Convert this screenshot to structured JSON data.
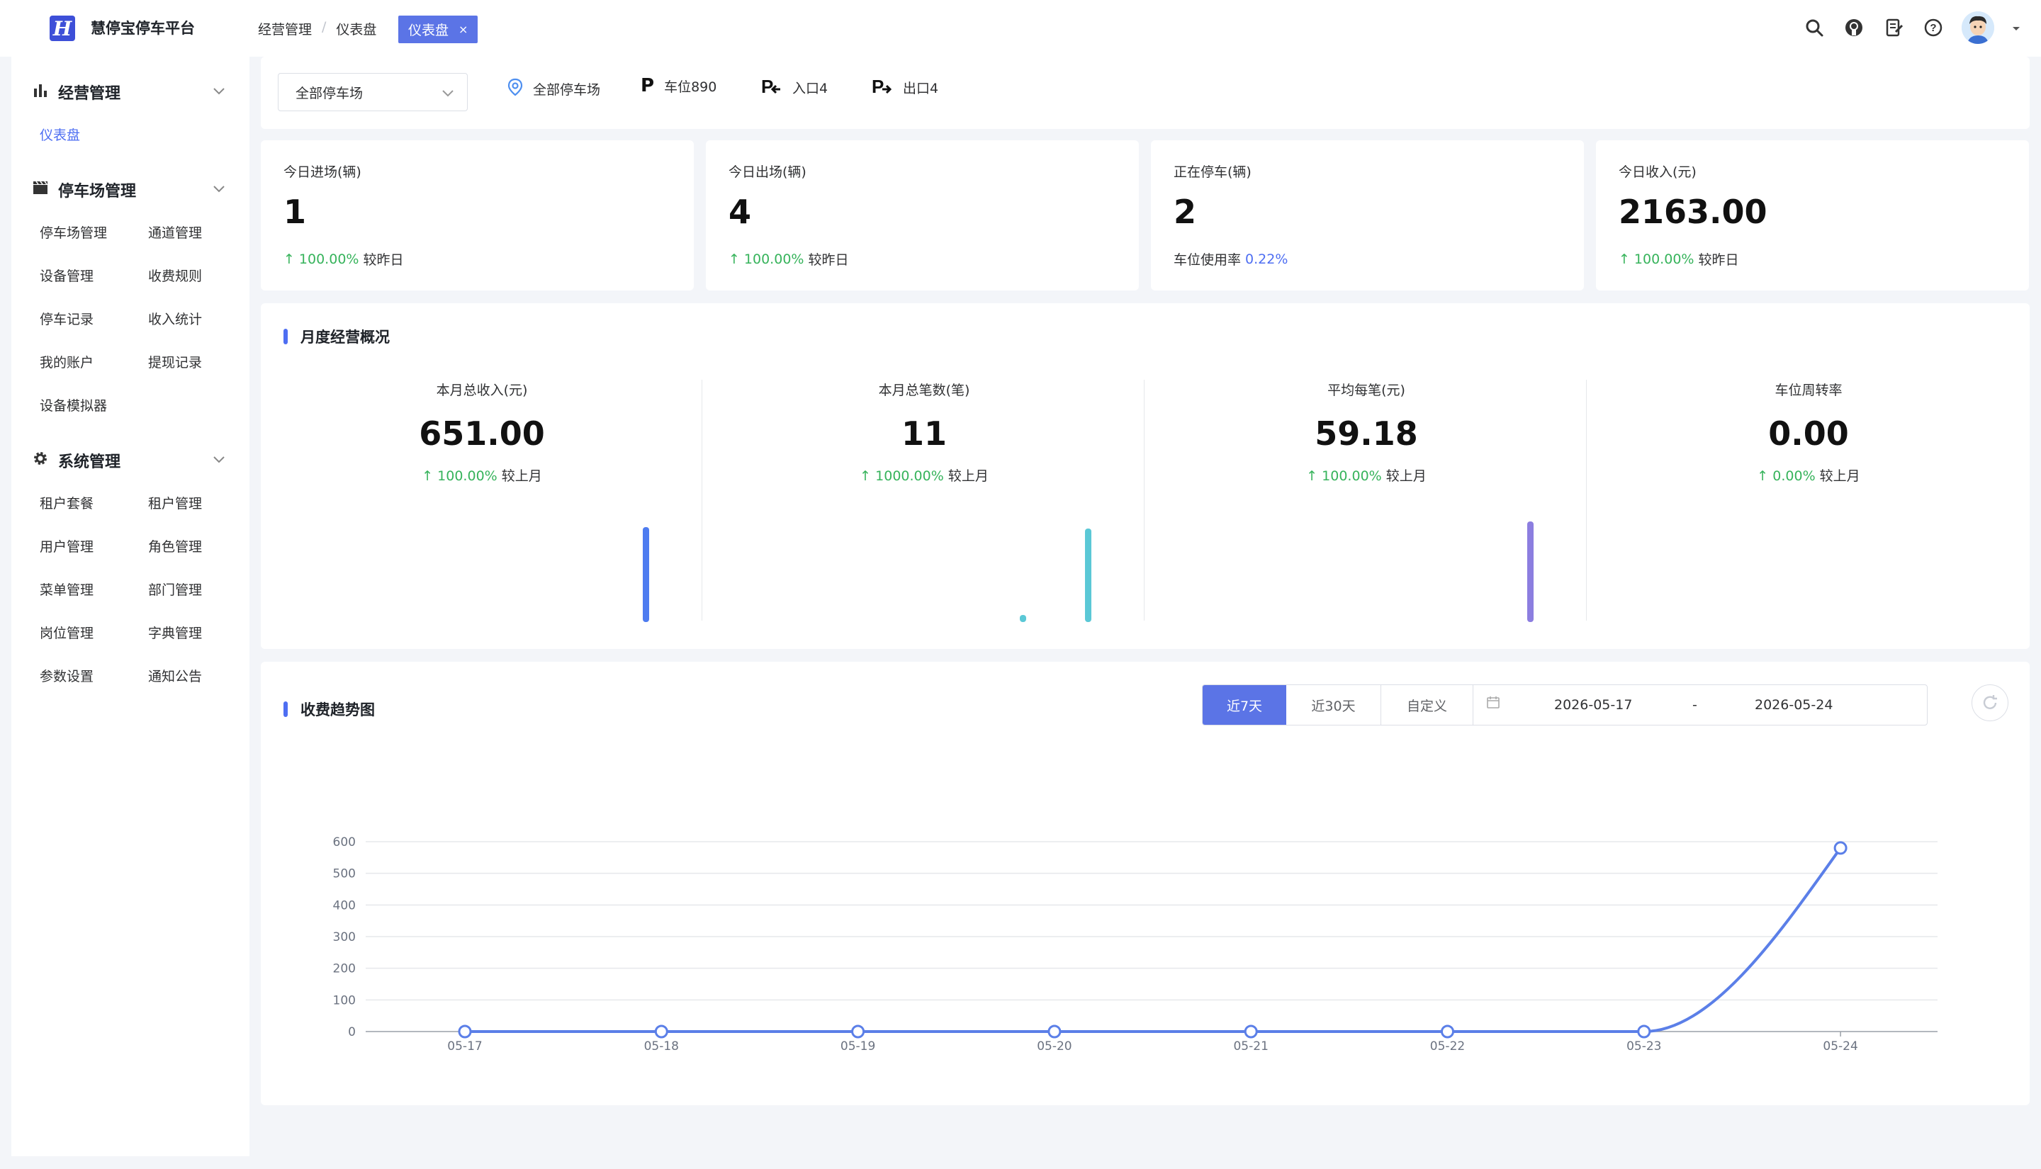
{
  "header": {
    "logo_letter": "H",
    "app_title": "慧停宝停车平台",
    "breadcrumb": [
      "经营管理",
      "仪表盘"
    ],
    "active_tab": "仪表盘",
    "tab_close": "×"
  },
  "sidebar": {
    "groups": [
      {
        "title": "经营管理",
        "icon": "bar-chart-icon",
        "items": [
          "仪表盘"
        ]
      },
      {
        "title": "停车场管理",
        "icon": "clapper-icon",
        "items": [
          "停车场管理",
          "通道管理",
          "设备管理",
          "收费规则",
          "停车记录",
          "收入统计",
          "我的账户",
          "提现记录",
          "设备模拟器"
        ]
      },
      {
        "title": "系统管理",
        "icon": "gear-icon",
        "items": [
          "租户套餐",
          "租户管理",
          "用户管理",
          "角色管理",
          "菜单管理",
          "部门管理",
          "岗位管理",
          "字典管理",
          "参数设置",
          "通知公告"
        ]
      }
    ],
    "active_item": "仪表盘"
  },
  "filter": {
    "select_value": "全部停车场",
    "location": "全部停车场",
    "spaces": "车位890",
    "entrances": "入口4",
    "exits": "出口4"
  },
  "stats": [
    {
      "label": "今日进场(辆)",
      "value": "1",
      "pct": "100.00%",
      "suffix": "较昨日",
      "arrow": "↑"
    },
    {
      "label": "今日出场(辆)",
      "value": "4",
      "pct": "100.00%",
      "suffix": "较昨日",
      "arrow": "↑"
    },
    {
      "label": "正在停车(辆)",
      "value": "2",
      "prefix": "车位使用率",
      "rate": "0.22%"
    },
    {
      "label": "今日收入(元)",
      "value": "2163.00",
      "pct": "100.00%",
      "suffix": "较昨日",
      "arrow": "↑"
    }
  ],
  "monthly": {
    "title": "月度经营概况",
    "items": [
      {
        "label": "本月总收入(元)",
        "value": "651.00",
        "pct": "100.00%",
        "suffix": "较上月",
        "arrow": "↑",
        "color": "#4e7cf0"
      },
      {
        "label": "本月总笔数(笔)",
        "value": "11",
        "pct": "1000.00%",
        "suffix": "较上月",
        "arrow": "↑",
        "color": "#5bc8d6"
      },
      {
        "label": "平均每笔(元)",
        "value": "59.18",
        "pct": "100.00%",
        "suffix": "较上月",
        "arrow": "↑",
        "color": "#8c7ee0"
      },
      {
        "label": "车位周转率",
        "value": "0.00",
        "pct": "0.00%",
        "suffix": "较上月",
        "arrow": "↑",
        "color": "#ffffff"
      }
    ]
  },
  "trend": {
    "title": "收费趋势图",
    "buttons": [
      "近7天",
      "近30天",
      "自定义"
    ],
    "active_button": "近7天",
    "date_start": "2026-05-17",
    "date_sep": "-",
    "date_end": "2026-05-24"
  },
  "chart_data": {
    "type": "line",
    "title": "收费趋势图",
    "x": [
      "05-17",
      "05-18",
      "05-19",
      "05-20",
      "05-21",
      "05-22",
      "05-23",
      "05-24"
    ],
    "series": [
      {
        "values": [
          0,
          0,
          0,
          0,
          0,
          0,
          0,
          580
        ]
      }
    ],
    "ylim": [
      0,
      600
    ],
    "yticks": [
      0,
      100,
      200,
      300,
      400,
      500,
      600
    ],
    "grid": true,
    "smooth": true,
    "color": "#5b7fe8"
  }
}
